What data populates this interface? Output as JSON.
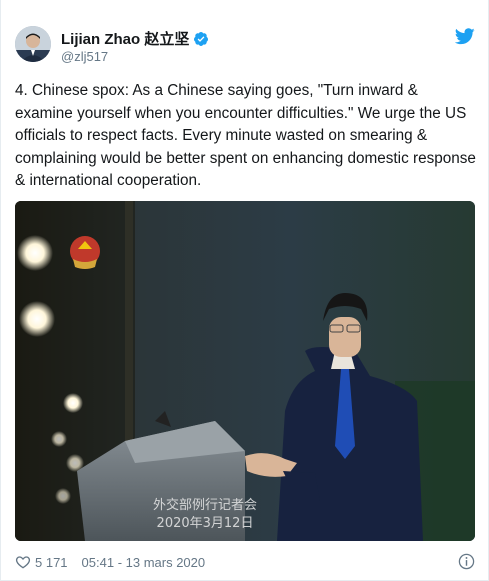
{
  "author": {
    "display_name": "Lijian Zhao 赵立坚",
    "handle": "@zlj517"
  },
  "tweet": {
    "text": "4. Chinese spox: As a Chinese saying goes, \"Turn inward & examine yourself when you encounter difficulties.\" We urge the US officials to respect facts. Every minute wasted on smearing & complaining would be better spent on enhancing domestic response & international cooperation."
  },
  "media": {
    "caption_line1": "外交部例行记者会",
    "caption_line2": "2020年3月12日"
  },
  "footer": {
    "like_count": "5 171",
    "timestamp": "05:41 - 13 mars 2020"
  },
  "icons": {
    "verified": "verified-badge-icon",
    "brand": "twitter-bird-icon",
    "like": "heart-icon",
    "info": "info-icon"
  },
  "colors": {
    "brand": "#1da1f2",
    "secondary_text": "#657786",
    "primary_text": "#14171a"
  }
}
